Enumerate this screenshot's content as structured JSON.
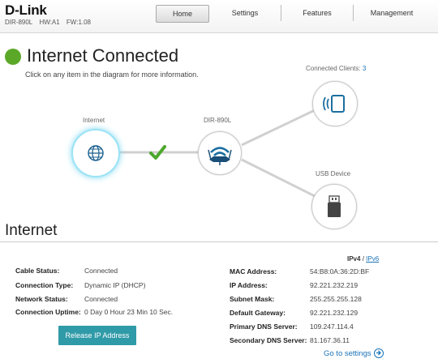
{
  "brand": {
    "logo": "D-Link",
    "model": "DIR-890L",
    "hw": "HW:A1",
    "fw": "FW:1.08"
  },
  "nav": {
    "home": "Home",
    "settings": "Settings",
    "features": "Features",
    "management": "Management"
  },
  "status": {
    "title": "Internet Connected",
    "subtitle": "Click on any item in the diagram for more information.",
    "color": "#5ba829"
  },
  "diagram": {
    "internet_label": "Internet",
    "router_label": "DIR-890L",
    "clients_label": "Connected Clients:",
    "clients_count": "3",
    "usb_label": "USB Device"
  },
  "internet": {
    "title": "Internet",
    "proto_v4": "IPv4",
    "proto_sep": "/",
    "proto_v6": "IPv6",
    "left": [
      {
        "key": "Cable Status:",
        "value": "Connected"
      },
      {
        "key": "Connection Type:",
        "value": "Dynamic IP (DHCP)"
      },
      {
        "key": "Network Status:",
        "value": "Connected"
      },
      {
        "key": "Connection Uptime:",
        "value": "0 Day 0 Hour 23 Min 10 Sec."
      }
    ],
    "right": [
      {
        "key": "MAC Address:",
        "value": "54:B8:0A:36:2D:BF"
      },
      {
        "key": "IP Address:",
        "value": "92.221.232.219"
      },
      {
        "key": "Subnet Mask:",
        "value": "255.255.255.128"
      },
      {
        "key": "Default Gateway:",
        "value": "92.221.232.129"
      },
      {
        "key": "Primary DNS Server:",
        "value": "109.247.114.4"
      },
      {
        "key": "Secondary DNS Server:",
        "value": "81.167.36.11"
      }
    ],
    "release_button": "Release IP Address",
    "goto_settings": "Go to settings"
  }
}
